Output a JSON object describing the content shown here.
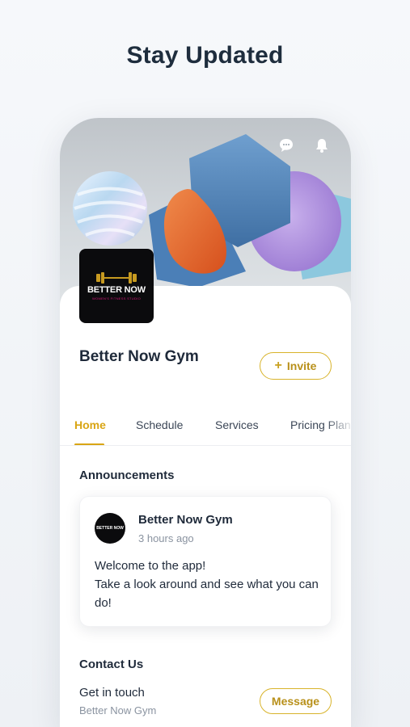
{
  "headline": "Stay Updated",
  "header": {
    "chat_icon": "chat-bubble-icon",
    "bell_icon": "bell-icon"
  },
  "profile": {
    "logo_title": "BETTER NOW",
    "logo_subtitle": "WOMEN'S FITNESS STUDIO",
    "name": "Better Now Gym",
    "invite_label": "Invite",
    "invite_icon": "plus-icon"
  },
  "tabs": [
    {
      "label": "Home",
      "active": true
    },
    {
      "label": "Schedule",
      "active": false
    },
    {
      "label": "Services",
      "active": false
    },
    {
      "label": "Pricing Plans",
      "active": false
    }
  ],
  "announcements": {
    "title": "Announcements",
    "post": {
      "author": "Better Now Gym",
      "time": "3 hours ago",
      "avatar_text": "BETTER NOW",
      "line1": "Welcome to the app!",
      "line2": "Take a look around and see what you can do!"
    }
  },
  "contact": {
    "title": "Contact Us",
    "label": "Get in touch",
    "sub": "Better Now Gym",
    "message_label": "Message"
  },
  "colors": {
    "accent": "#d9a514",
    "text": "#1f2a3a",
    "muted": "#8a93a0"
  }
}
